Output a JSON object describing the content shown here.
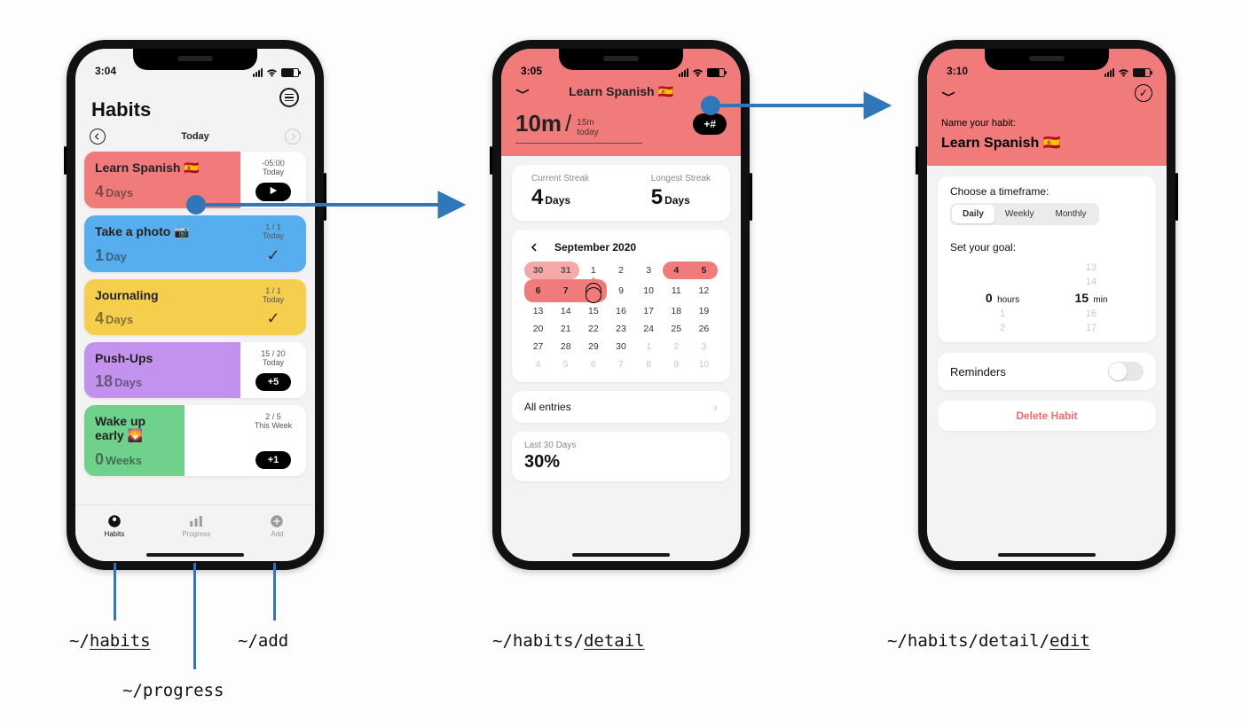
{
  "colors": {
    "accent": "#f17b7b",
    "arrow": "#2f77b8"
  },
  "phone1": {
    "status_time": "3:04",
    "settings_name": "menu-icon",
    "title": "Habits",
    "day_label": "Today",
    "habits": [
      {
        "name": "Learn Spanish 🇪🇸",
        "streak_n": "4",
        "streak_unit": "Days",
        "right_top": "-05:00",
        "right_sub": "Today",
        "action": "▶",
        "color": "red"
      },
      {
        "name": "Take a photo 📷",
        "streak_n": "1",
        "streak_unit": "Day",
        "right_top": "1 / 1",
        "right_sub": "Today",
        "action": "✓",
        "color": "blue"
      },
      {
        "name": "Journaling",
        "streak_n": "4",
        "streak_unit": "Days",
        "right_top": "1 / 1",
        "right_sub": "Today",
        "action": "✓",
        "color": "yellow"
      },
      {
        "name": "Push-Ups",
        "streak_n": "18",
        "streak_unit": "Days",
        "right_top": "15 / 20",
        "right_sub": "Today",
        "action": "+5",
        "color": "purple"
      },
      {
        "name": "Wake up early 🌄",
        "streak_n": "0",
        "streak_unit": "Weeks",
        "right_top": "2 / 5",
        "right_sub": "This Week",
        "action": "+1",
        "color": "green"
      }
    ],
    "tabs": [
      {
        "label": "Habits",
        "route": "~/habits"
      },
      {
        "label": "Progress",
        "route": "~/progress"
      },
      {
        "label": "Add",
        "route": "~/add"
      }
    ]
  },
  "phone2": {
    "status_time": "3:05",
    "title": "Learn Spanish 🇪🇸",
    "metric_big": "10m",
    "metric_of_top": "15m",
    "metric_of_bot": "today",
    "metric_action": "+#",
    "current_label": "Current Streak",
    "current_n": "4",
    "current_unit": "Days",
    "longest_label": "Longest Streak",
    "longest_n": "5",
    "longest_unit": "Days",
    "cal_month": "September 2020",
    "all_entries": "All entries",
    "last30_label": "Last 30 Days",
    "last30_value": "30%"
  },
  "phone3": {
    "status_time": "3:10",
    "name_label": "Name your habit:",
    "name_value": "Learn Spanish 🇪🇸",
    "timeframe_label": "Choose a timeframe:",
    "timeframe_opts": [
      "Daily",
      "Weekly",
      "Monthly"
    ],
    "timeframe_selected": "Daily",
    "goal_label": "Set your goal:",
    "hours_value": "0",
    "hours_unit": "hours",
    "mins_value": "15",
    "mins_unit": "min",
    "mins_ghost_above2": "13",
    "mins_ghost_above": "14",
    "hours_ghost_below": "1",
    "mins_ghost_below": "16",
    "hours_ghost_below2": "2",
    "mins_ghost_below2": "17",
    "reminders_label": "Reminders",
    "delete_label": "Delete Habit"
  },
  "routes": {
    "habits": "~/habits",
    "progress": "~/progress",
    "add": "~/add",
    "detail": "~/habits/detail",
    "edit": "~/habits/detail/edit"
  }
}
